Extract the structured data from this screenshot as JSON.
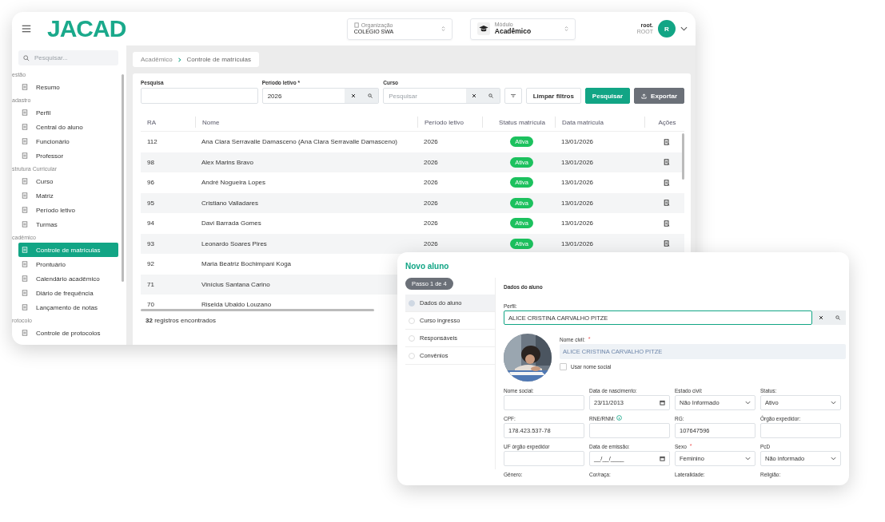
{
  "app": {
    "logo": "JACAD",
    "organization": {
      "label": "Organização",
      "value": "COLEGIO SWA"
    },
    "module": {
      "label": "Módulo",
      "value": "Acadêmico"
    },
    "user": {
      "name": "root.",
      "role": "ROOT",
      "initial": "R"
    },
    "sidebar": {
      "search_placeholder": "Pesquisar...",
      "groups": [
        {
          "title": "estão",
          "items": [
            {
              "label": "Resumo",
              "selected": false
            }
          ]
        },
        {
          "title": "adastro",
          "items": [
            {
              "label": "Perfil",
              "selected": false
            },
            {
              "label": "Central do aluno",
              "selected": false
            },
            {
              "label": "Funcionário",
              "selected": false
            },
            {
              "label": "Professor",
              "selected": false
            }
          ]
        },
        {
          "title": "strutura Curricular",
          "items": [
            {
              "label": "Curso",
              "selected": false
            },
            {
              "label": "Matriz",
              "selected": false
            },
            {
              "label": "Período letivo",
              "selected": false
            },
            {
              "label": "Turmas",
              "selected": false
            }
          ]
        },
        {
          "title": "cadêmico",
          "items": [
            {
              "label": "Controle de matrículas",
              "selected": true
            },
            {
              "label": "Prontuário",
              "selected": false
            },
            {
              "label": "Calendário acadêmico",
              "selected": false
            },
            {
              "label": "Diário de frequência",
              "selected": false
            },
            {
              "label": "Lançamento de notas",
              "selected": false
            }
          ]
        },
        {
          "title": "rotocolo",
          "items": [
            {
              "label": "Controle de protocolos",
              "selected": false
            }
          ]
        }
      ]
    },
    "breadcrumb": [
      "Acadêmico",
      "Controle de matrículas"
    ],
    "filters": {
      "search_label": "Pesquisa",
      "period_label": "Período letivo *",
      "period_value": "2026",
      "course_label": "Curso",
      "course_placeholder": "Pesquisar",
      "clear_button": "Limpar filtros",
      "search_button": "Pesquisar",
      "export_button": "Exportar"
    },
    "table": {
      "columns": [
        "RA",
        "Nome",
        "Período letivo",
        "Status matrícula",
        "Data matrícula",
        "Ações"
      ],
      "rows": [
        {
          "ra": "112",
          "name": "Ana Clara Serravalle Damasceno (Ana Clara Serravalle Damasceno)",
          "period": "2026",
          "status": "Ativa",
          "date": "13/01/2026"
        },
        {
          "ra": "98",
          "name": "Alex Marins Bravo",
          "period": "2026",
          "status": "Ativa",
          "date": "13/01/2026"
        },
        {
          "ra": "96",
          "name": "André Nogueira Lopes",
          "period": "2026",
          "status": "Ativa",
          "date": "13/01/2026"
        },
        {
          "ra": "95",
          "name": "Cristiano Valladares",
          "period": "2026",
          "status": "Ativa",
          "date": "13/01/2026"
        },
        {
          "ra": "94",
          "name": "Davi Barrada Gomes",
          "period": "2026",
          "status": "Ativa",
          "date": "13/01/2026"
        },
        {
          "ra": "93",
          "name": "Leonardo Soares Pires",
          "period": "2026",
          "status": "Ativa",
          "date": "13/01/2026"
        },
        {
          "ra": "92",
          "name": "Maria Beatriz Bochimpani Koga"
        },
        {
          "ra": "71",
          "name": "Vinícius Santana Carino"
        },
        {
          "ra": "70",
          "name": "Riselda Ubaldo Louzano"
        }
      ],
      "footer_count": "32",
      "footer_text": "registros encontrados"
    }
  },
  "dialog": {
    "title": "Novo aluno",
    "step_badge": "Passo 1 de 4",
    "steps": [
      {
        "label": "Dados do aluno",
        "selected": true
      },
      {
        "label": "Curso ingresso",
        "selected": false
      },
      {
        "label": "Responsáveis",
        "selected": false
      },
      {
        "label": "Convênios",
        "selected": false
      }
    ],
    "section_title": "Dados do aluno",
    "profile": {
      "label": "Perfil:",
      "value": "ALICE CRISTINA CARVALHO PITZE"
    },
    "civil_name": {
      "label": "Nome civil:",
      "required_mark": "*",
      "value": "ALICE CRISTINA CARVALHO PITZE"
    },
    "social_name_checkbox": {
      "label": "Usar nome social",
      "checked": false
    },
    "fields": [
      {
        "kind": "text",
        "label": "Nome social:"
      },
      {
        "kind": "date",
        "label": "Data de nascimento:",
        "value": "23/11/2013"
      },
      {
        "kind": "select",
        "label": "Estado civil:",
        "value": "Não Informado"
      },
      {
        "kind": "select",
        "label": "Status:",
        "value": "Ativo"
      },
      {
        "kind": "text",
        "label": "CPF:",
        "value": "178.423.537-78"
      },
      {
        "kind": "text",
        "label": "RNE/RNM:",
        "info": true
      },
      {
        "kind": "text",
        "label": "RG:",
        "value": "107647596"
      },
      {
        "kind": "text",
        "label": "Órgão expedidor:"
      },
      {
        "kind": "text",
        "label": "UF órgão expedidor"
      },
      {
        "kind": "date",
        "label": "Data de emissão:",
        "value": "__/__/____"
      },
      {
        "kind": "select",
        "label": "Sexo",
        "required_mark": "*",
        "value": "Feminino"
      },
      {
        "kind": "select",
        "label": "PcD",
        "value": "Não informado"
      },
      {
        "kind": "label",
        "label": "Gênero:"
      },
      {
        "kind": "label",
        "label": "Cor/raça:"
      },
      {
        "kind": "label",
        "label": "Lateralidade:"
      },
      {
        "kind": "label",
        "label": "Religião:"
      }
    ]
  }
}
